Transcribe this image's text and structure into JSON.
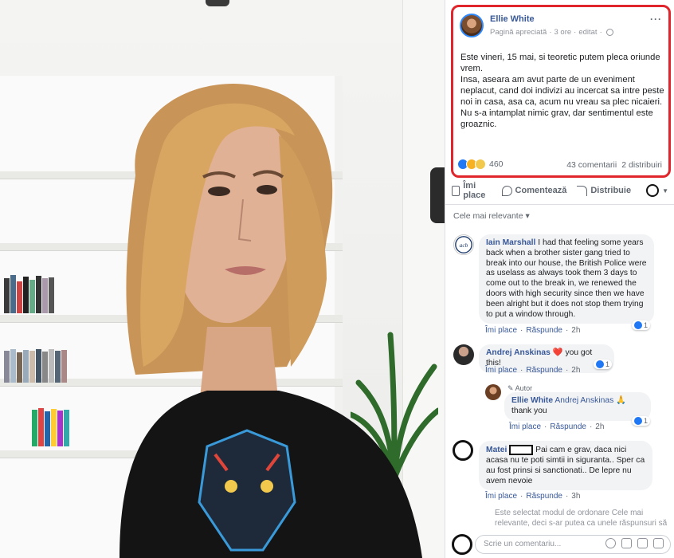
{
  "post": {
    "author": "Ellie White",
    "meta_page": "Pagină apreciată",
    "meta_time": "3 ore",
    "meta_edited": "editat",
    "text_lines": [
      "Este vineri, 15 mai, si teoretic putem pleca oriunde vrem.",
      "Insa, aseara am avut parte de un eveniment neplacut, cand doi indivizi au incercat sa intre peste noi in casa, asa ca, acum nu vreau sa plec nicaieri.",
      "Nu s-a intamplat nimic grav, dar sentimentul este groaznic."
    ],
    "reaction_count": "460",
    "comments_count": "43 comentarii",
    "shares_count": "2 distribuiri"
  },
  "actions": {
    "like": "Îmi place",
    "comment": "Comentează",
    "share": "Distribuie"
  },
  "sort_label": "Cele mai relevante ▾",
  "comments": [
    {
      "name": "Iain Marshall",
      "text": "I had that feeling some years back when a brother sister gang tried to break into our house, the British Police were as uselass as always took them 3 days to come out to the break in, we renewed the doors with high security since then we have been alright but it does not stop them trying to put a window through.",
      "like": "Îmi place",
      "reply": "Răspunde",
      "time": "2h",
      "likes": "1"
    },
    {
      "name": "Andrej Anskinas",
      "text": "you got this!",
      "heart": "❤️",
      "like": "Îmi place",
      "reply": "Răspunde",
      "time": "2h",
      "likes": "1"
    },
    {
      "author_tag": "Autor",
      "name": "Ellie White",
      "mention": "Andrej Anskinas",
      "emoji": "🙏",
      "text": "thank you",
      "like": "Îmi place",
      "reply": "Răspunde",
      "time": "2h",
      "likes": "1"
    },
    {
      "name": "Matei",
      "text": "Pai cam e grav, daca nici acasa nu te poti simtii in siguranta.. Sper ca au fost prinsi si sanctionati.. De lepre nu avem nevoie",
      "like": "Îmi place",
      "reply": "Răspunde",
      "time": "3h"
    }
  ],
  "footer_note": "Este selectat modul de ordonare Cele mai relevante, deci s-ar putea ca unele răspunsuri să",
  "composer": {
    "placeholder": "Scrie un comentariu..."
  },
  "colors": {
    "highlight_border": "#e0262c",
    "link": "#385898",
    "like_blue": "#2078f4"
  },
  "icons": [
    "like-icon",
    "comment-icon",
    "share-icon",
    "globe-icon",
    "more-icon",
    "emoji-icon",
    "camera-icon",
    "gif-icon",
    "sticker-icon"
  ]
}
